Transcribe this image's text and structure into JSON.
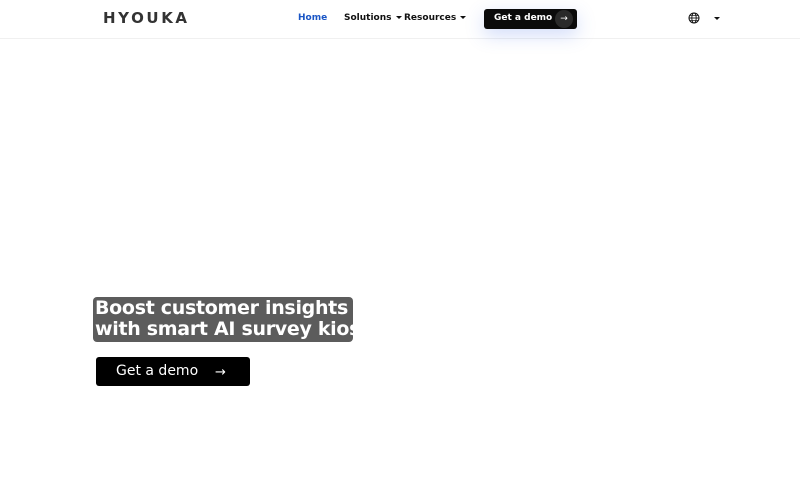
{
  "header": {
    "logo": "HYOUKA",
    "nav": {
      "home": "Home",
      "solutions": "Solutions",
      "resources": "Resources"
    },
    "cta_label": "Get a demo",
    "cta_arrow": "→",
    "icons": {
      "language": "globe-icon",
      "caret": "chevron-down-icon"
    }
  },
  "hero": {
    "title_line1": "Boost customer insights",
    "title_line2": "with smart AI survey kiosk",
    "cta_label": "Get a demo",
    "cta_arrow": "→"
  },
  "colors": {
    "active_nav": "#1a56c6",
    "button_bg": "#0b0b0b",
    "title_highlight": "#464646"
  }
}
